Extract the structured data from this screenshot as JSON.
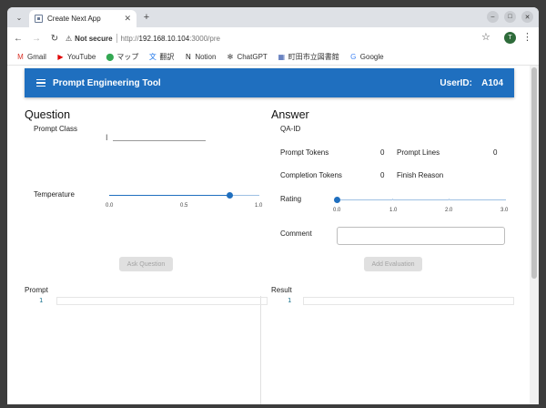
{
  "browser": {
    "tab_title": "Create Next App",
    "security_label": "Not secure",
    "url_scheme": "http://",
    "url_host": "192.168.10.104",
    "url_path": ":3000/pre",
    "profile_initial": "T",
    "bookmarks": [
      {
        "label": "Gmail",
        "icon": "M",
        "color": "#d93025"
      },
      {
        "label": "YouTube",
        "icon": "▶",
        "color": "#e00000"
      },
      {
        "label": "マップ",
        "icon": "⬤",
        "color": "#34a853"
      },
      {
        "label": "翻訳",
        "icon": "文",
        "color": "#1a73e8"
      },
      {
        "label": "Notion",
        "icon": "N",
        "color": "#111111"
      },
      {
        "label": "ChatGPT",
        "icon": "✻",
        "color": "#444444"
      },
      {
        "label": "町田市立図書館",
        "icon": "▦",
        "color": "#3355aa"
      },
      {
        "label": "Google",
        "icon": "G",
        "color": "#4285f4"
      }
    ]
  },
  "app": {
    "title": "Prompt Engineering Tool",
    "user_label": "UserID:",
    "user_id": "A104",
    "accent": "#1f6fbf"
  },
  "question": {
    "title": "Question",
    "prompt_class_label": "Prompt Class",
    "temperature_label": "Temperature",
    "temperature_value": 0.8,
    "temperature_ticks": [
      "0.0",
      "0.5",
      "1.0"
    ],
    "ask_button": "Ask Question"
  },
  "answer": {
    "title": "Answer",
    "qa_id_label": "QA-ID",
    "prompt_tokens_label": "Prompt Tokens",
    "prompt_tokens_value": "0",
    "prompt_lines_label": "Prompt Lines",
    "prompt_lines_value": "0",
    "completion_tokens_label": "Completion Tokens",
    "completion_tokens_value": "0",
    "finish_reason_label": "Finish Reason",
    "rating_label": "Rating",
    "rating_value": 0.0,
    "rating_ticks": [
      "0.0",
      "1.0",
      "2.0",
      "3.0"
    ],
    "comment_label": "Comment",
    "add_eval_button": "Add Evaluation"
  },
  "editors": {
    "prompt_label": "Prompt",
    "result_label": "Result",
    "line_number": "1"
  }
}
